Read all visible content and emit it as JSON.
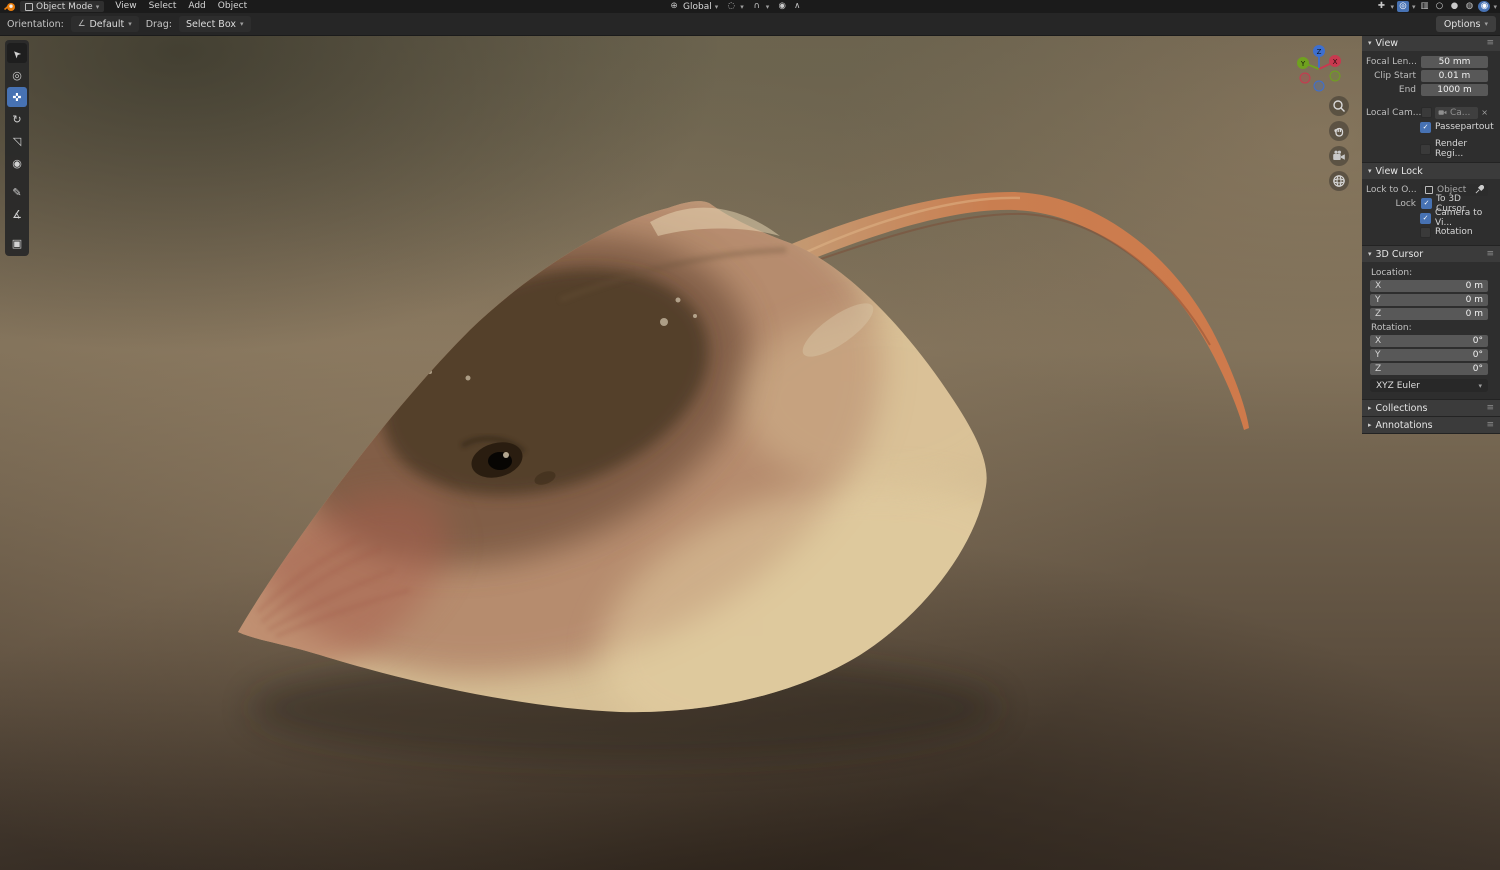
{
  "topbar": {
    "mode_label": "Object Mode",
    "menus": [
      "View",
      "Select",
      "Add",
      "Object"
    ],
    "transform_orientation": "Global",
    "options_label": "Options"
  },
  "header2": {
    "orientation_label": "Orientation:",
    "orientation_value": "Default",
    "drag_label": "Drag:",
    "drag_value": "Select Box"
  },
  "tools": [
    {
      "name": "tweak-select",
      "glyph": "➤",
      "active": false
    },
    {
      "name": "cursor",
      "glyph": "◎",
      "active": false
    },
    {
      "name": "move",
      "glyph": "✜",
      "active": true
    },
    {
      "name": "rotate",
      "glyph": "↻",
      "active": false
    },
    {
      "name": "scale",
      "glyph": "◹",
      "active": false
    },
    {
      "name": "transform",
      "glyph": "◉",
      "active": false
    },
    {
      "name": "annotate",
      "glyph": "✎",
      "active": false
    },
    {
      "name": "measure",
      "glyph": "∡",
      "active": false
    },
    {
      "name": "add-cube",
      "glyph": "▣",
      "active": false
    }
  ],
  "gizmo": {
    "x": "X",
    "y": "Y",
    "z": "Z"
  },
  "sidebar": {
    "view": {
      "title": "View",
      "rows": [
        {
          "label": "Focal Len...",
          "value": "50 mm"
        },
        {
          "label": "Clip Start",
          "value": "0.01 m"
        },
        {
          "label": "End",
          "value": "1000 m"
        }
      ],
      "local_cam_label": "Local Cam...",
      "local_cam_value": "Ca...",
      "passepartout_label": "Passepartout",
      "passepartout_checked": true,
      "render_region_label": "Render Regi...",
      "render_region_checked": false
    },
    "view_lock": {
      "title": "View Lock",
      "lock_to_label": "Lock to O...",
      "lock_to_value": "Object",
      "lock_label": "Lock",
      "checks": [
        {
          "label": "To 3D Cursor",
          "checked": true
        },
        {
          "label": "Camera to Vi...",
          "checked": true
        },
        {
          "label": "Rotation",
          "checked": false
        }
      ]
    },
    "cursor3d": {
      "title": "3D Cursor",
      "location_label": "Location:",
      "location": [
        {
          "axis": "X",
          "value": "0 m"
        },
        {
          "axis": "Y",
          "value": "0 m"
        },
        {
          "axis": "Z",
          "value": "0 m"
        }
      ],
      "rotation_label": "Rotation:",
      "rotation": [
        {
          "axis": "X",
          "value": "0°"
        },
        {
          "axis": "Y",
          "value": "0°"
        },
        {
          "axis": "Z",
          "value": "0°"
        }
      ],
      "euler_mode": "XYZ Euler"
    },
    "collections_title": "Collections",
    "annotations_title": "Annotations"
  },
  "glyphs": {
    "chevron_down": "▾",
    "chevron_right": "▸",
    "grip": "≡",
    "check": "✓",
    "close": "×",
    "globe": "⊕",
    "pivot": "◌",
    "magnet": "∩",
    "proportional": "◉",
    "falloff": "∧",
    "orientation": "∠",
    "gizmo_toggle": "✚",
    "overlays": "◎",
    "xray": "▥",
    "shade_wire": "○",
    "shade_solid": "●",
    "shade_material": "◍",
    "shade_rendered": "◉"
  },
  "colors": {
    "accent": "#4772b3"
  }
}
